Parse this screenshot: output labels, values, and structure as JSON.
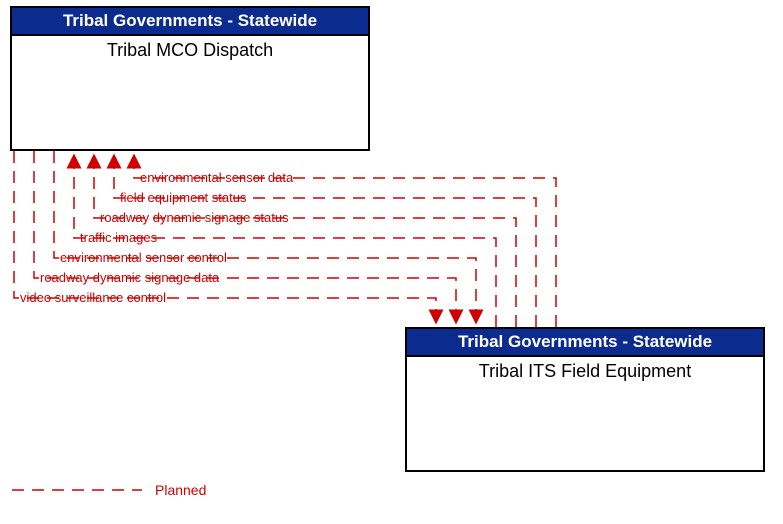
{
  "nodes": {
    "top": {
      "header": "Tribal Governments - Statewide",
      "body": "Tribal MCO Dispatch"
    },
    "bottom": {
      "header": "Tribal Governments - Statewide",
      "body": "Tribal ITS Field Equipment"
    }
  },
  "flows": {
    "to_top": [
      "environmental sensor data",
      "field equipment status",
      "roadway dynamic signage status",
      "traffic images"
    ],
    "to_bottom": [
      "environmental sensor control",
      "roadway dynamic signage data",
      "video surveillance control"
    ]
  },
  "legend": {
    "planned": "Planned"
  }
}
